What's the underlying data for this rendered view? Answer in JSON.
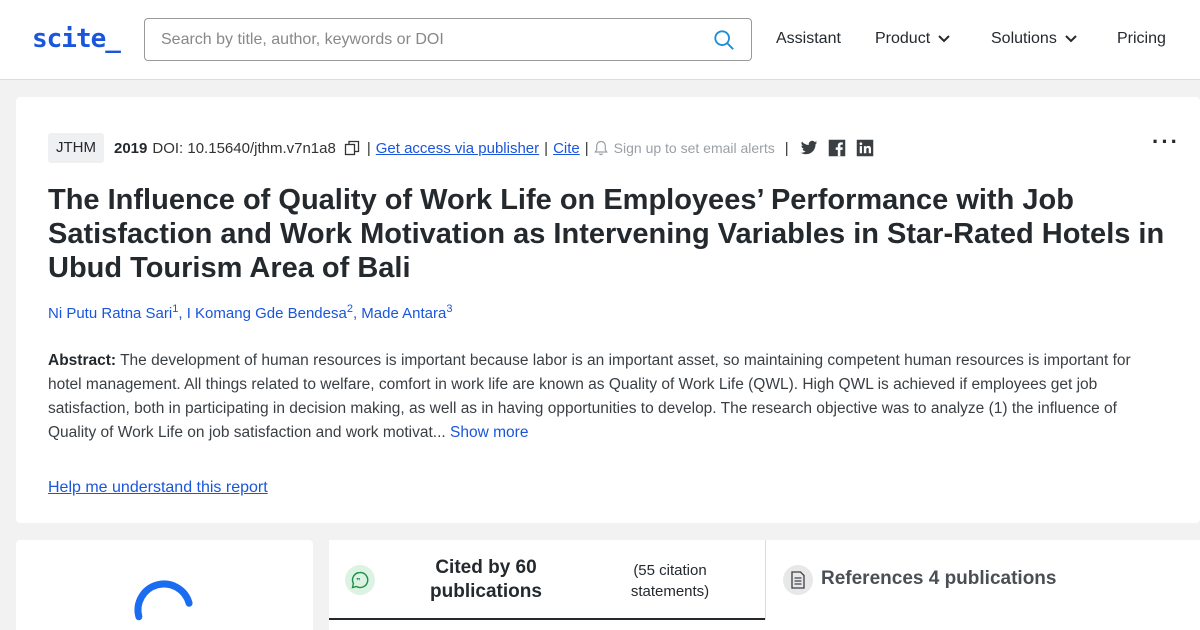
{
  "header": {
    "logo": "scite_",
    "search_placeholder": "Search by title, author, keywords or DOI",
    "nav": {
      "assistant": "Assistant",
      "product": "Product",
      "solutions": "Solutions",
      "pricing": "Pricing"
    }
  },
  "paper": {
    "journal": "JTHM",
    "year": "2019",
    "doi": "DOI: 10.15640/jthm.v7n1a8",
    "get_access": "Get access via publisher",
    "cite": "Cite",
    "alerts": "Sign up to set email alerts",
    "more": "···",
    "title": "The Influence of Quality of Work Life on Employees’ Performance with Job Satisfaction and Work Motivation as Intervening Variables in Star-Rated Hotels in Ubud Tourism Area of Bali",
    "authors": [
      {
        "name": "Ni Putu Ratna Sari",
        "sup": "1"
      },
      {
        "name": "I Komang Gde Bendesa",
        "sup": "2"
      },
      {
        "name": "Made Antara",
        "sup": "3"
      }
    ],
    "abstract_label": "Abstract:",
    "abstract_text": " The development of human resources is important because labor is an important asset, so maintaining competent human resources is important for hotel management. All things related to welfare, comfort in work life are known as Quality of Work Life (QWL). High QWL is achieved if employees get job satisfaction, both in participating in decision making, as well as in having opportunities to develop. The research objective was to analyze (1) the influence of Quality of Work Life on job satisfaction and work motivat...",
    "show_more": "Show more",
    "help": "Help me understand this report"
  },
  "tabs": {
    "cited_by": "Cited by 60 publications",
    "cited_statements": "(55 citation statements)",
    "references": "References 4 publications"
  },
  "colors": {
    "accent": "#1a56db",
    "text": "#24292e",
    "background": "#f2f2f2"
  }
}
